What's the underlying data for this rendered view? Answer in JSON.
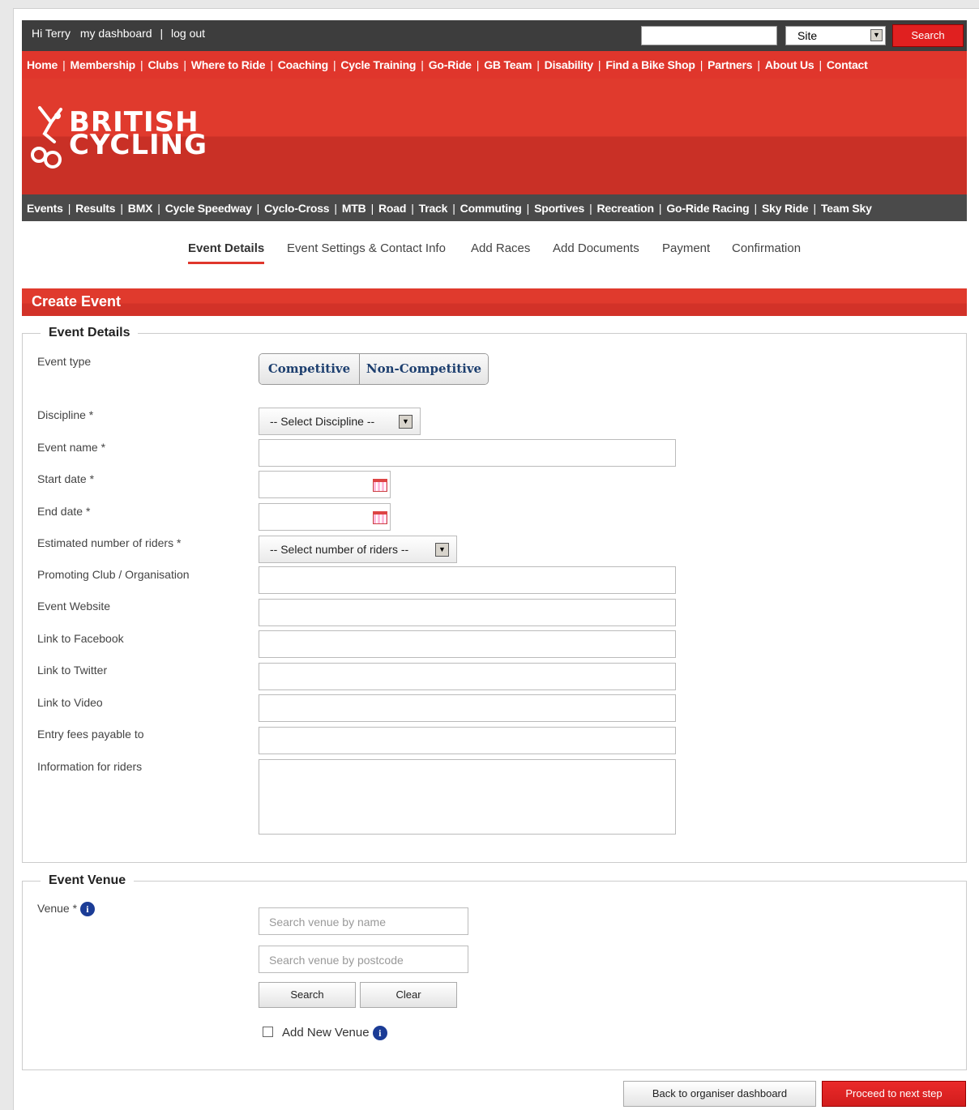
{
  "topbar": {
    "greeting": "Hi Terry",
    "dashboard": "my dashboard",
    "separator": "|",
    "logout": "log out",
    "search_value": "",
    "site_select": "Site",
    "search_button": "Search"
  },
  "main_nav": [
    "Home",
    "Membership",
    "Clubs",
    "Where to Ride",
    "Coaching",
    "Cycle Training",
    "Go-Ride",
    "GB Team",
    "Disability",
    "Find a Bike Shop",
    "Partners",
    "About Us",
    "Contact"
  ],
  "logo": {
    "line1": "BRITISH",
    "line2": "CYCLING"
  },
  "sub_nav": [
    "Events",
    "Results",
    "BMX",
    "Cycle Speedway",
    "Cyclo-Cross",
    "MTB",
    "Road",
    "Track",
    "Commuting",
    "Sportives",
    "Recreation",
    "Go-Ride Racing",
    "Sky Ride",
    "Team Sky"
  ],
  "steps": [
    "Event Details",
    "Event Settings & Contact Info",
    "Add Races",
    "Add Documents",
    "Payment",
    "Confirmation"
  ],
  "active_step": "Event Details",
  "page_title": "Create Event",
  "event_details": {
    "legend": "Event Details",
    "event_type_label": "Event type",
    "event_type_options": [
      "Competitive",
      "Non-Competitive"
    ],
    "discipline_label": "Discipline *",
    "discipline_value": "-- Select Discipline --",
    "event_name_label": "Event name *",
    "start_date_label": "Start date *",
    "end_date_label": "End date *",
    "riders_label": "Estimated number of riders *",
    "riders_value": "-- Select number of riders --",
    "club_label": "Promoting Club / Organisation",
    "website_label": "Event Website",
    "facebook_label": "Link to Facebook",
    "twitter_label": "Link to Twitter",
    "video_label": "Link to Video",
    "fees_label": "Entry fees payable to",
    "info_label": "Information for riders"
  },
  "venue": {
    "legend": "Event Venue",
    "venue_label": "Venue *",
    "name_placeholder": "Search venue by name",
    "postcode_placeholder": "Search venue by postcode",
    "search_button": "Search",
    "clear_button": "Clear",
    "add_new_label": "Add New Venue",
    "add_new_checked": false
  },
  "footer": {
    "back_button": "Back to organiser dashboard",
    "next_button": "Proceed to next step"
  },
  "colors": {
    "brand_red": "#e0362c",
    "dark_bar": "#3d3d3d",
    "toggle_text": "#1d3f6f",
    "info_icon": "#1b3c96"
  }
}
